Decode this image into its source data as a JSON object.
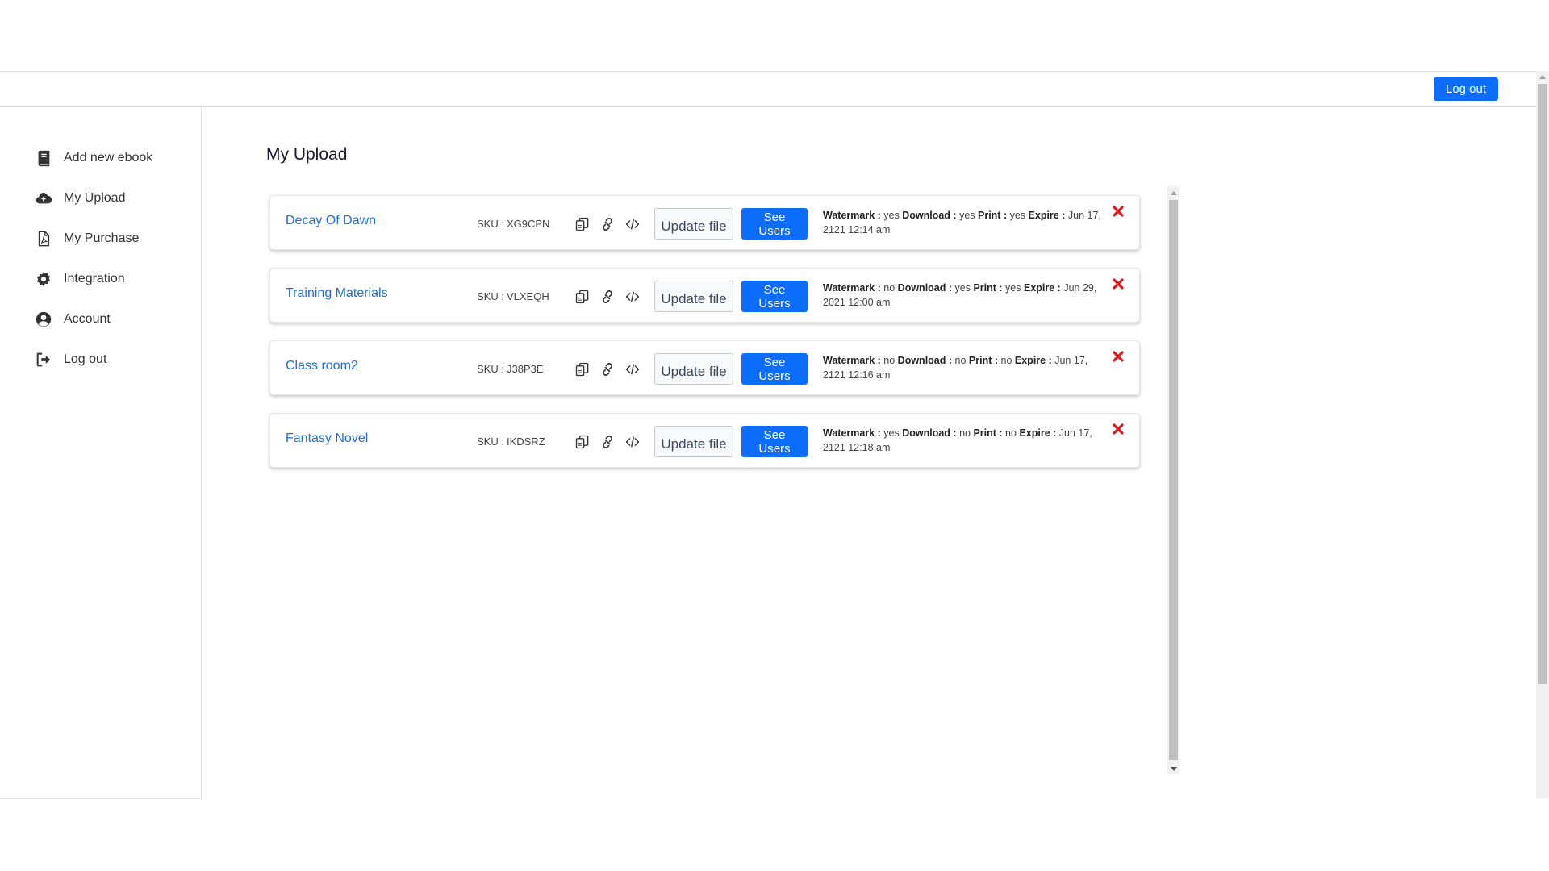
{
  "header": {
    "logout_label": "Log out"
  },
  "sidebar": {
    "items": [
      {
        "label": "Add new ebook",
        "icon": "book-icon"
      },
      {
        "label": "My Upload",
        "icon": "cloud-upload-icon"
      },
      {
        "label": "My Purchase",
        "icon": "pdf-file-icon"
      },
      {
        "label": "Integration",
        "icon": "gear-icon"
      },
      {
        "label": "Account",
        "icon": "user-circle-icon"
      },
      {
        "label": "Log out",
        "icon": "sign-out-icon"
      }
    ]
  },
  "main": {
    "title": "My Upload",
    "sku_label": "SKU :",
    "update_label": "Update file",
    "users_label": "See Users",
    "meta_labels": {
      "watermark": "Watermark :",
      "download": "Download :",
      "print": "Print :",
      "expire": "Expire :"
    },
    "icons": [
      "copy-icon",
      "link-icon",
      "code-icon",
      "delete-icon"
    ],
    "uploads": [
      {
        "title": "Decay Of Dawn",
        "sku": "XG9CPN",
        "watermark": "yes",
        "download": "yes",
        "print": "yes",
        "expire": "Jun 17, 2121 12:14 am"
      },
      {
        "title": "Training Materials",
        "sku": "VLXEQH",
        "watermark": "no",
        "download": "yes",
        "print": "yes",
        "expire": "Jun 29, 2021 12:00 am"
      },
      {
        "title": "Class room2",
        "sku": "J38P3E",
        "watermark": "no",
        "download": "no",
        "print": "no",
        "expire": "Jun 17, 2121 12:16 am"
      },
      {
        "title": "Fantasy Novel",
        "sku": "IKDSRZ",
        "watermark": "yes",
        "download": "no",
        "print": "no",
        "expire": "Jun 17, 2121 12:18 am"
      }
    ]
  },
  "colors": {
    "primary": "#0d6efd",
    "link": "#1a6fd6",
    "delete": "#e3151a"
  }
}
